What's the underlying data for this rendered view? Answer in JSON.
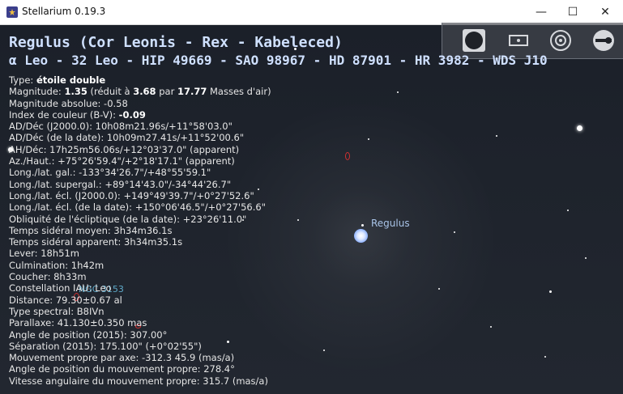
{
  "window": {
    "title": "Stellarium 0.19.3",
    "controls": {
      "minimize": "—",
      "maximize": "☐",
      "close": "✕"
    }
  },
  "toolbar": {
    "icons": [
      "ground-icon",
      "mount-icon",
      "atmosphere-icon",
      "wrench-icon"
    ]
  },
  "object": {
    "title_line1": "Regulus (Cor Leonis - Rex - Kabeleced)",
    "title_line2": "α Leo - 32 Leo - HIP 49669 - SAO 98967 - HD 87901 - HR 3982 - WDS J10",
    "lines": [
      {
        "label": "Type: ",
        "value": "étoile double"
      },
      {
        "label": "Magnitude: ",
        "bold1": "1.35",
        "mid": " (réduit à ",
        "bold2": "3.68",
        "mid2": " par ",
        "bold3": "17.77",
        "tail": " Masses d'air)"
      },
      {
        "text": "Magnitude absolue: -0.58"
      },
      {
        "label": "Index de couleur (B-V): ",
        "value": "-0.09"
      },
      {
        "text": "AD/Déc (J2000.0): 10h08m21.96s/+11°58'03.0\""
      },
      {
        "text": "AD/Déc (de la date): 10h09m27.41s/+11°52'00.6\""
      },
      {
        "text": "AH/Déc: 17h25m56.06s/+12°03'37.0\" (apparent)"
      },
      {
        "text": "Az./Haut.: +75°26'59.4\"/+2°18'17.1\" (apparent)"
      },
      {
        "text": "Long./lat. gal.: -133°34'26.7\"/+48°55'59.1\""
      },
      {
        "text": "Long./lat. supergal.: +89°14'43.0\"/-34°44'26.7\""
      },
      {
        "text": "Long./lat. écl. (J2000.0): +149°49'39.7\"/+0°27'52.6\""
      },
      {
        "text": "Long./lat. écl. (de la date): +150°06'46.5\"/+0°27'56.6\""
      },
      {
        "text": "Obliquité de l'écliptique (de la date): +23°26'11.0\""
      },
      {
        "text": "Temps sidéral moyen: 3h34m36.1s"
      },
      {
        "text": "Temps sidéral apparent: 3h34m35.1s"
      },
      {
        "text": "Lever: 18h51m"
      },
      {
        "text": "Culmination: 1h42m"
      },
      {
        "text": "Coucher: 8h33m"
      },
      {
        "text": "Constellation IAU: Leo"
      },
      {
        "text": "Distance: 79.30±0.67 al"
      },
      {
        "text": "Type spectral: B8IVn"
      },
      {
        "text": "Parallaxe: 41.130±0.350 mas"
      },
      {
        "text": "Angle de position (2015): 307.00°"
      },
      {
        "text": "Séparation (2015): 175.100\" (+0°02'55\")"
      },
      {
        "text": "Mouvement propre par axe: -312.3 45.9 (mas/a)"
      },
      {
        "text": "Angle de position du mouvement propre: 278.4°"
      },
      {
        "text": "Vitesse angulaire du mouvement propre: 315.7 (mas/a)"
      }
    ]
  },
  "sky_labels": {
    "regulus": "Regulus",
    "ngc": "NGC 3153"
  },
  "colors": {
    "sky": "#1e232c",
    "info_text": "#e6e6e6",
    "title_text": "#cfe0ff",
    "star_label": "#a9c4e8",
    "nebula_label": "#5ea9c9",
    "marker": "#d23030"
  }
}
